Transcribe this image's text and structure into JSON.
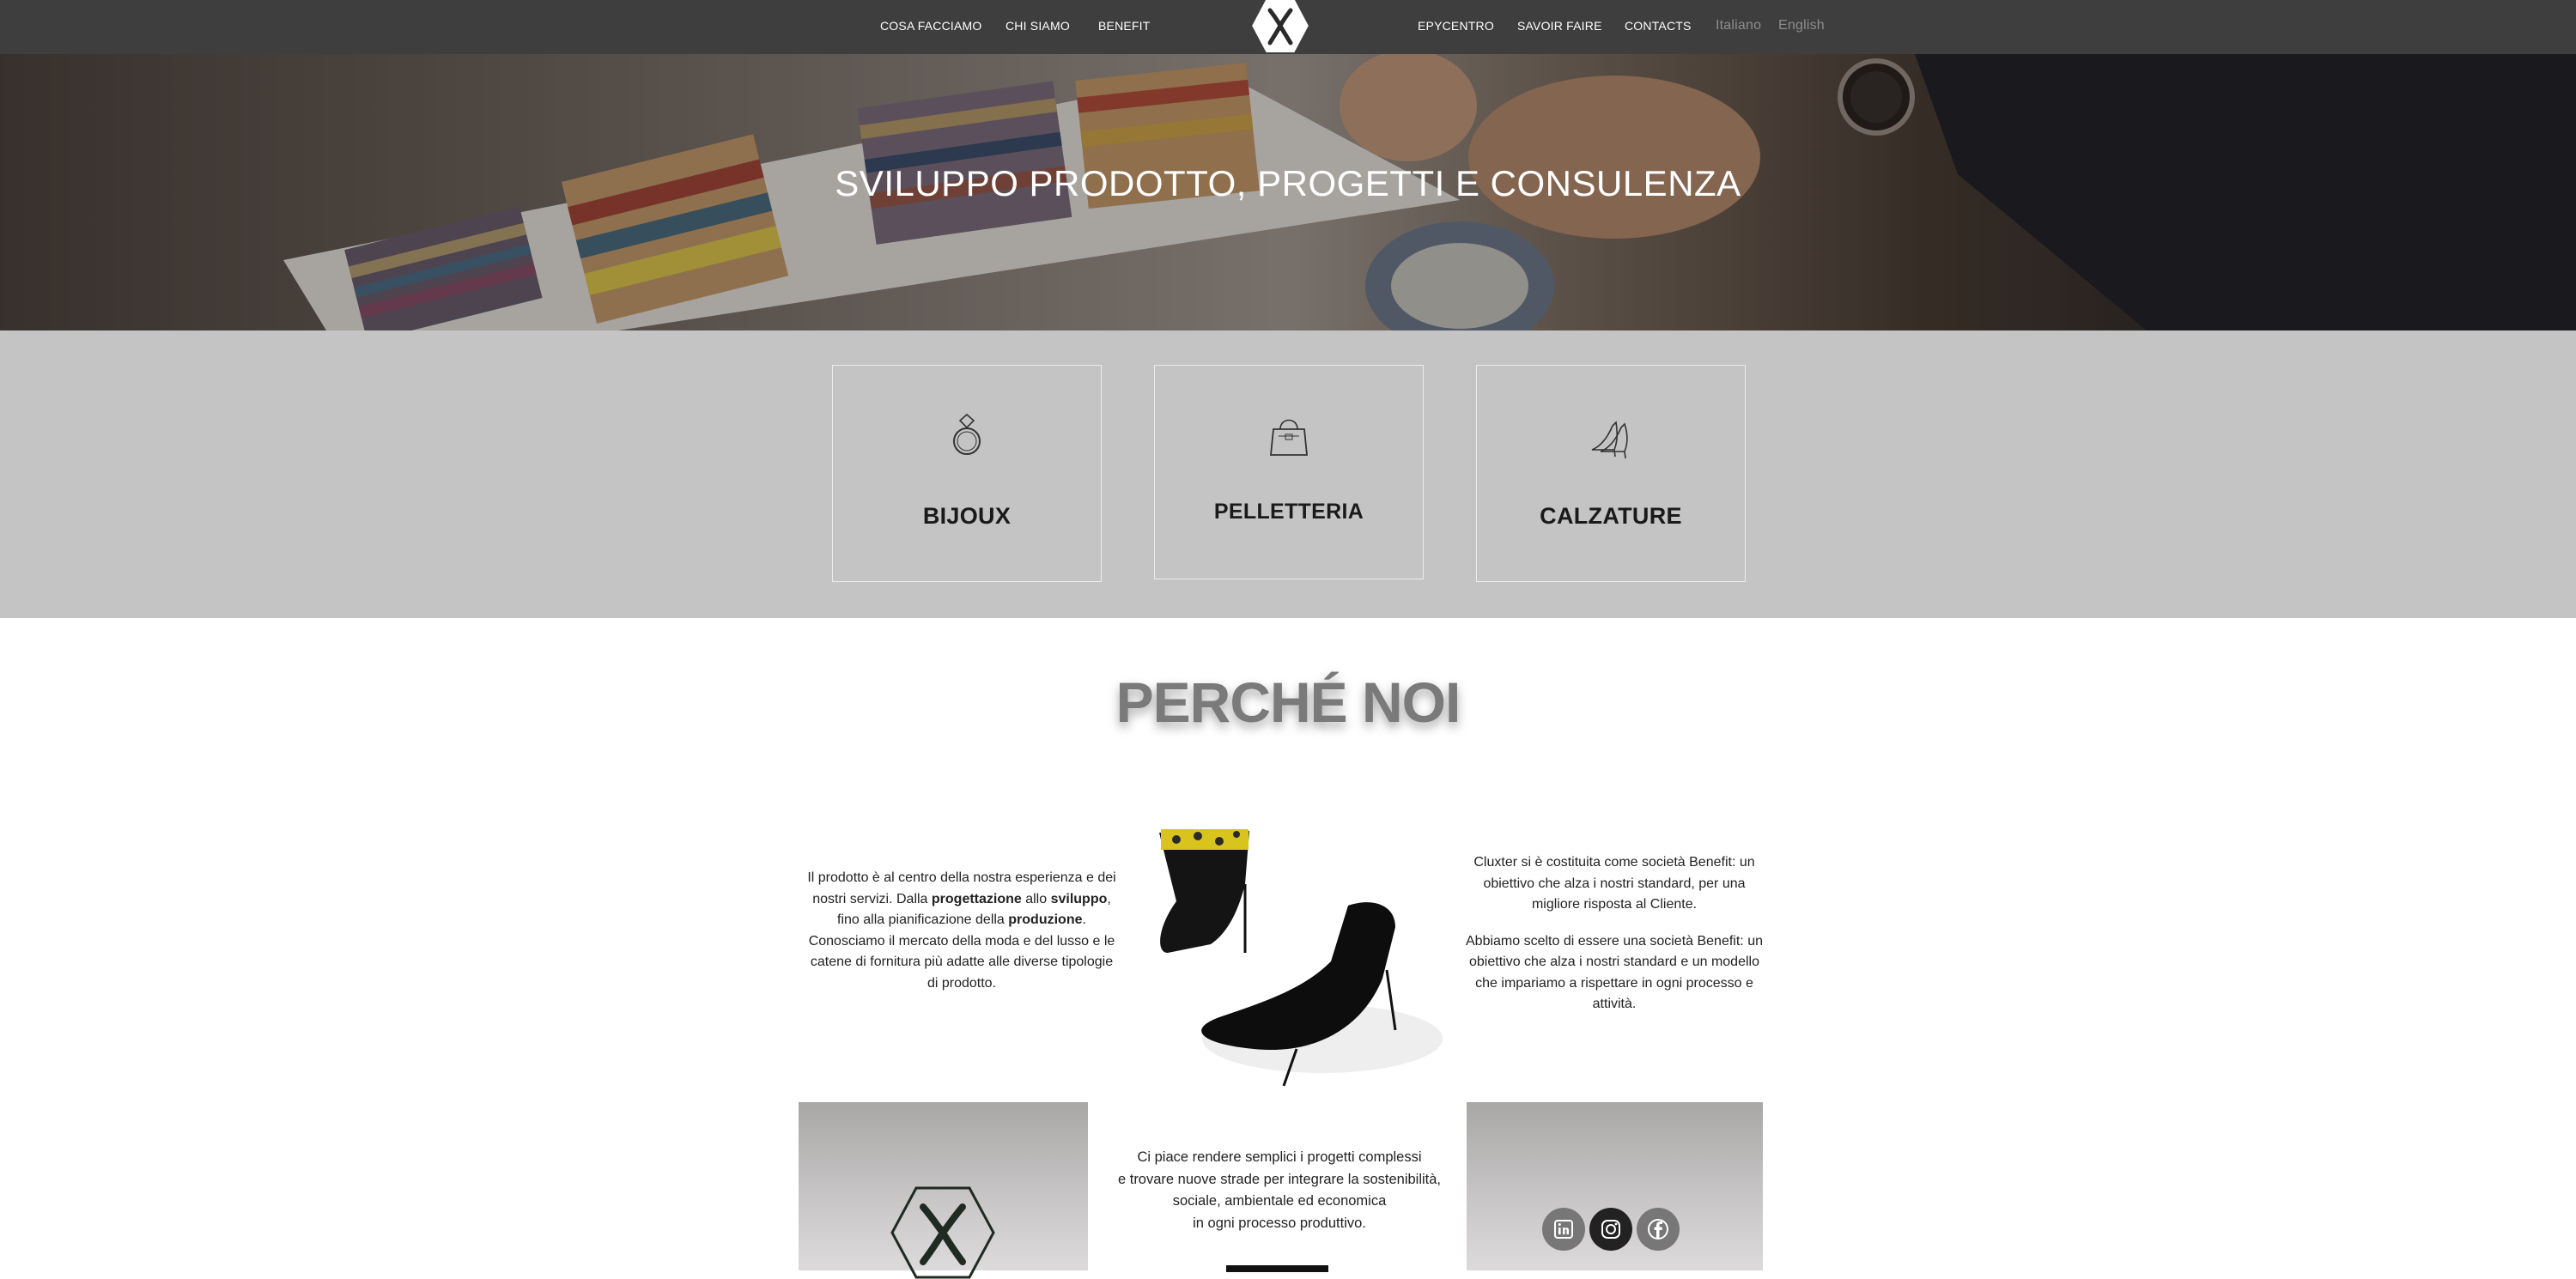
{
  "nav": {
    "left_items": [
      "COSA FACCIAMO",
      "CHI SIAMO",
      "BENEFIT"
    ],
    "right_items": [
      "EPYCENTRO",
      "SAVOIR FAIRE",
      "CONTACTS"
    ],
    "languages": [
      "Italiano",
      "English"
    ]
  },
  "hero": {
    "title": "SVILUPPO PRODOTTO, PROGETTI E CONSULENZA"
  },
  "categories": [
    {
      "label": "BIJOUX",
      "icon": "ring-icon"
    },
    {
      "label": "PELLETTERIA",
      "icon": "handbag-icon"
    },
    {
      "label": "CALZATURE",
      "icon": "high-heels-icon"
    }
  ],
  "why": {
    "title": "PERCHÉ NOI",
    "left_text": {
      "line1": "Il prodotto è al centro della nostra esperienza e dei nostri servizi. Dalla ",
      "bold1": "progettazione",
      "mid1": " allo ",
      "bold2": "sviluppo",
      "mid2": ", fino alla pianificazione della ",
      "bold3": "produzione",
      "end": ". Conosciamo il mercato della moda e del lusso e le catene di fornitura più adatte alle diverse tipologie di prodotto."
    },
    "right_text": [
      "Cluxter si è costituita come società Benefit: un obiettivo che alza i nostri standard, per una migliore risposta al Cliente.",
      "Abbiamo scelto di essere una società Benefit: un obiettivo che alza i nostri standard e un modello che impariamo a rispettare in ogni processo e attività."
    ],
    "center_lines": [
      "Ci piace rendere semplici i progetti complessi",
      "e trovare nuove strade per integrare la sostenibilità,",
      "sociale, ambientale ed economica",
      "in ogni processo produttivo."
    ]
  },
  "social": [
    "linkedin-icon",
    "instagram-icon",
    "facebook-icon"
  ],
  "colors": {
    "nav_bg": "#3e3e3e",
    "band_bg": "#c4c4c4",
    "title_gray": "#7a7a7a"
  }
}
